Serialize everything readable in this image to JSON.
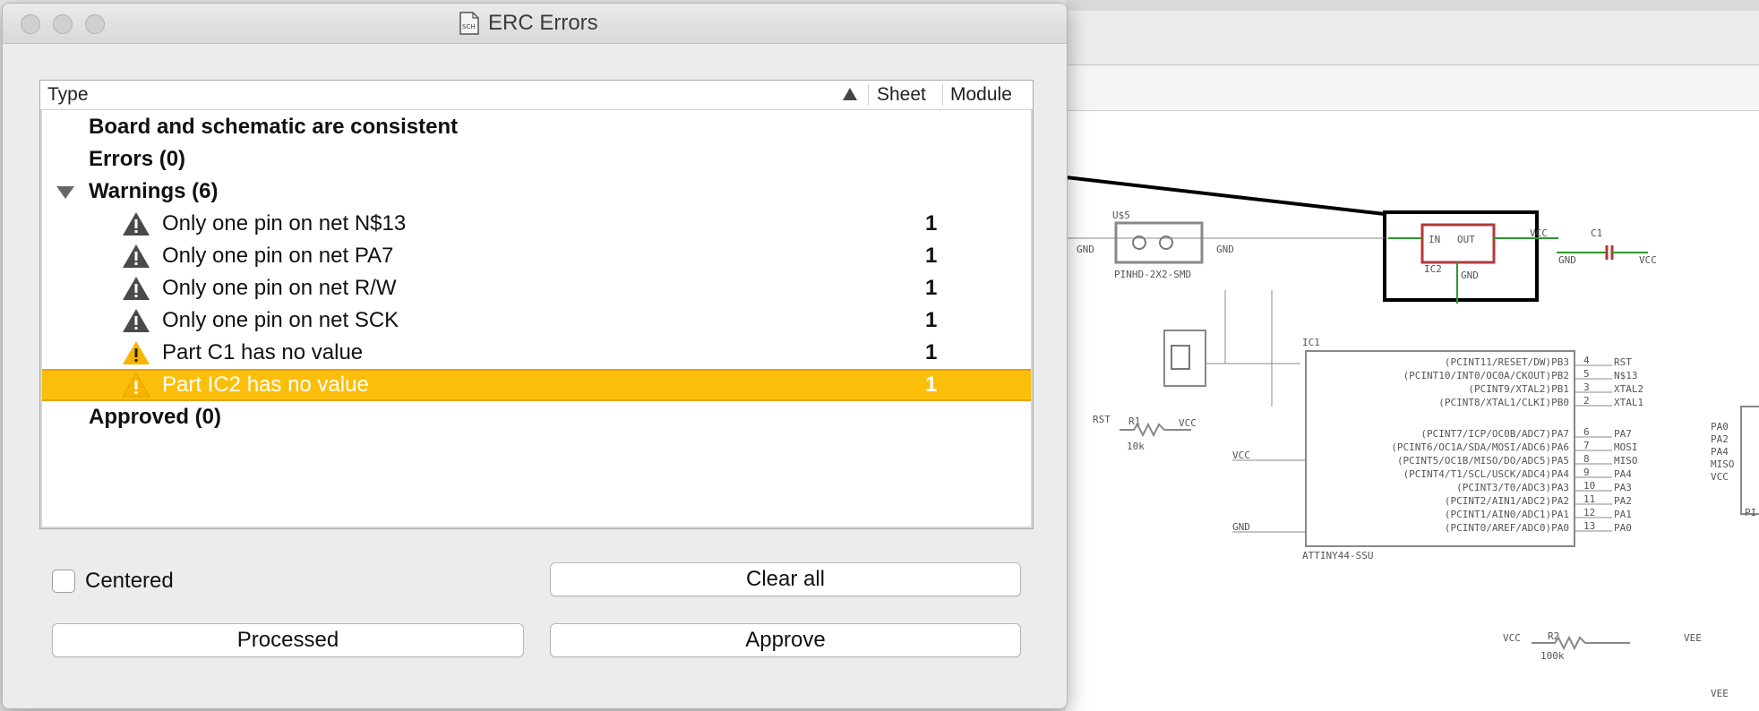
{
  "window": {
    "title": "ERC Errors",
    "doc_icon_text": "SCH"
  },
  "table": {
    "columns": [
      "Type",
      "Sheet",
      "Module"
    ],
    "sort_column": "Type",
    "sort_direction": "ascending",
    "rows": [
      {
        "label": "Board and schematic are consistent",
        "bold": true
      },
      {
        "label": "Errors (0)",
        "bold": true
      },
      {
        "label": "Warnings (6)",
        "bold": true,
        "expanded": true
      },
      {
        "label": "Only one pin on net N$13",
        "sheet": "1",
        "icon": "warning-gray-icon"
      },
      {
        "label": "Only one pin on net PA7",
        "sheet": "1",
        "icon": "warning-gray-icon"
      },
      {
        "label": "Only one pin on net R/W",
        "sheet": "1",
        "icon": "warning-gray-icon"
      },
      {
        "label": "Only one pin on net SCK",
        "sheet": "1",
        "icon": "warning-gray-icon"
      },
      {
        "label": "Part C1 has no value",
        "sheet": "1",
        "icon": "warning-yellow-icon"
      },
      {
        "label": "Part IC2 has no value",
        "sheet": "1",
        "icon": "warning-yellow-icon",
        "selected": true
      },
      {
        "label": "Approved (0)",
        "bold": true
      }
    ]
  },
  "controls": {
    "centered_label": "Centered",
    "centered_checked": false,
    "clear_all_label": "Clear all",
    "processed_label": "Processed",
    "approve_label": "Approve"
  },
  "colors": {
    "selection": "#fbbf0b",
    "warning_yellow": "#f7b500",
    "warning_gray": "#555555"
  },
  "schematic_labels": {
    "u_label": "U$5",
    "pinhd": "PINHD-2X2-SMD",
    "gnd": "GND",
    "vcc": "VCC",
    "in": "IN",
    "out": "OUT",
    "ic2": "IC2",
    "c1": "C1",
    "ic1": "IC1",
    "rst": "RST",
    "r1": "R1",
    "r1_val": "10k",
    "r2": "R2",
    "r2_val": "100k",
    "vee": "VEE",
    "attiny": "ATTINY44-SSU",
    "pins_right": [
      "(PCINT11/RESET/DW)PB3",
      "(PCINT10/INT0/OC0A/CKOUT)PB2",
      "(PCINT9/XTAL2)PB1",
      "(PCINT8/XTAL1/CLKI)PB0",
      "(PCINT7/ICP/OC0B/ADC7)PA7",
      "(PCINT6/OC1A/SDA/MOSI/ADC6)PA6",
      "(PCINT5/OC1B/MISO/DO/ADC5)PA5",
      "(PCINT4/T1/SCL/USCK/ADC4)PA4",
      "(PCINT3/T0/ADC3)PA3",
      "(PCINT2/AIN1/ADC2)PA2",
      "(PCINT1/AIN0/ADC1)PA1",
      "(PCINT0/AREF/ADC0)PA0"
    ],
    "pin_numbers": [
      "4",
      "5",
      "3",
      "2",
      "6",
      "7",
      "8",
      "9",
      "10",
      "11",
      "12",
      "13"
    ],
    "net_names": [
      "RST",
      "N$13",
      "XTAL2",
      "XTAL1",
      "PA7",
      "MOSI",
      "MISO",
      "PA4",
      "PA3",
      "PA2",
      "PA1",
      "PA0"
    ],
    "far_right_nets": [
      "PA0",
      "PA2",
      "PA4",
      "MISO",
      "VCC"
    ],
    "pi_label": "PI"
  }
}
